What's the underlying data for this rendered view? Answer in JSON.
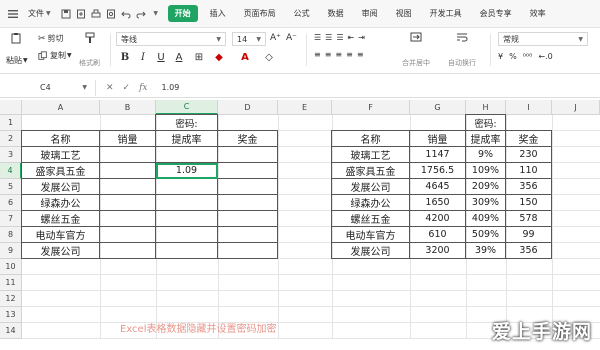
{
  "menubar": {
    "file_menu": "文件",
    "tabs": [
      "开始",
      "插入",
      "页面布局",
      "公式",
      "数据",
      "审阅",
      "视图",
      "开发工具",
      "会员专享",
      "效率"
    ],
    "active_tab": "开始"
  },
  "ribbon": {
    "cut": "剪切",
    "copy": "复制",
    "format_painter": "格式刷",
    "paste": "粘贴",
    "font_name": "等线",
    "font_size": "14",
    "merge_center": "合并居中",
    "auto_wrap": "自动换行",
    "general": "常规",
    "currency_symbol": "¥"
  },
  "formula_bar": {
    "cell_ref": "C4",
    "formula": "1.09"
  },
  "sheet": {
    "columns": [
      "A",
      "B",
      "C",
      "D",
      "E",
      "F",
      "G",
      "H",
      "I",
      "J"
    ],
    "selected_column": "C",
    "rows": [
      "1",
      "2",
      "3",
      "4",
      "5",
      "6",
      "7",
      "8",
      "9",
      "10",
      "11",
      "12",
      "13",
      "14"
    ],
    "selected_row": "4",
    "left_table": {
      "password_label": "密码:",
      "headers": [
        "名称",
        "销量",
        "提成率",
        "奖金"
      ],
      "names": [
        "玻璃工艺",
        "盛家具五金",
        "发展公司",
        "绿森办公",
        "螺丝五金",
        "电动车官方",
        "发展公司"
      ],
      "c4_value": "1.09"
    },
    "right_table": {
      "password_label": "密码:",
      "headers": [
        "名称",
        "销量",
        "提成率",
        "奖金"
      ],
      "rows": [
        [
          "玻璃工艺",
          "1147",
          "9%",
          "230"
        ],
        [
          "盛家具五金",
          "1756.5",
          "109%",
          "110"
        ],
        [
          "发展公司",
          "4645",
          "209%",
          "356"
        ],
        [
          "绿森办公",
          "1650",
          "309%",
          "150"
        ],
        [
          "螺丝五金",
          "4200",
          "409%",
          "578"
        ],
        [
          "电动车官方",
          "610",
          "509%",
          "99"
        ],
        [
          "发展公司",
          "3200",
          "39%",
          "356"
        ]
      ]
    },
    "caption": "Excel表格数据隐藏并设置密码加密"
  },
  "watermark": "爱上手游网",
  "colors": {
    "accent": "#1fa463",
    "caption": "#e8958a"
  }
}
